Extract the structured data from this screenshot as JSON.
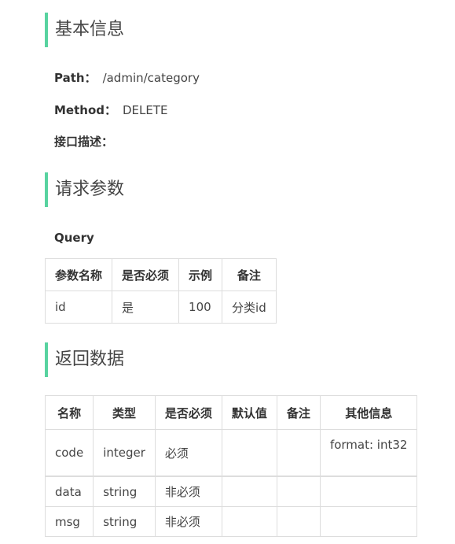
{
  "basic": {
    "title": "基本信息",
    "path_label": "Path：",
    "path_value": "/admin/category",
    "method_label": "Method：",
    "method_value": "DELETE",
    "desc_label": "接口描述："
  },
  "request": {
    "title": "请求参数",
    "query_label": "Query",
    "headers": [
      "参数名称",
      "是否必须",
      "示例",
      "备注"
    ],
    "rows": [
      [
        "id",
        "是",
        "100",
        "分类id"
      ]
    ]
  },
  "response": {
    "title": "返回数据",
    "headers": [
      "名称",
      "类型",
      "是否必须",
      "默认值",
      "备注",
      "其他信息"
    ],
    "rows": [
      [
        "code",
        "integer",
        "必须",
        "",
        "",
        "format: int32"
      ],
      [
        "data",
        "string",
        "非必须",
        "",
        "",
        ""
      ],
      [
        "msg",
        "string",
        "非必须",
        "",
        "",
        ""
      ]
    ]
  },
  "colors": {
    "accent": "#58d3a0",
    "border": "#dddddd"
  }
}
